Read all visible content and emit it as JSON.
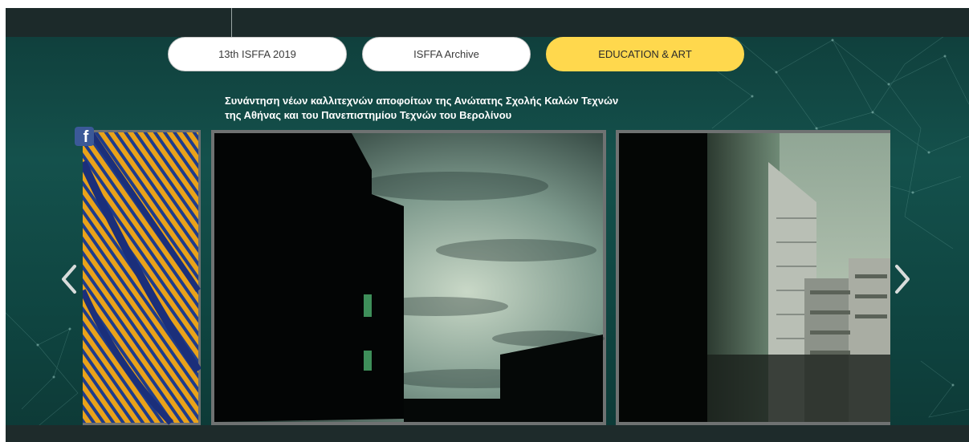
{
  "nav": {
    "tabs": [
      {
        "label": "13th ISFFA 2019",
        "active": false
      },
      {
        "label": "ISFFA Archive",
        "active": false
      },
      {
        "label": "EDUCATION & ART",
        "active": true
      }
    ]
  },
  "headline": {
    "line1": "Συνάντηση νέων καλλιτεχνών αποφοίτων της Ανώτατης Σχολής Καλών Τεχνών",
    "line2": "της Αθήνας και του Πανεπιστημίου Τεχνών του Βερολίνου"
  },
  "social": {
    "facebook_glyph": "f"
  },
  "gallery": {
    "icons": {
      "prev": "chevron-left-icon",
      "next": "chevron-right-icon"
    }
  },
  "colors": {
    "background": "#14514c",
    "active_tab": "#ffd84d",
    "facebook": "#3b5998"
  }
}
